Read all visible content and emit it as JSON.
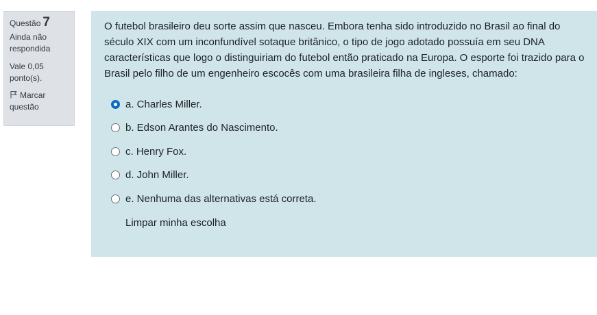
{
  "info": {
    "question_label": "Questão",
    "question_number": "7",
    "state": "Ainda não respondida",
    "grade": "Vale 0,05 ponto(s).",
    "flag_label": "Marcar questão"
  },
  "question": {
    "text": "O futebol brasileiro deu sorte assim que nasceu. Embora tenha sido introduzido no Brasil ao final do século XIX com um inconfundível sotaque britânico, o tipo de jogo adotado possuía em seu DNA características que logo o distinguiriam do futebol então praticado na Europa. O esporte foi trazido para o Brasil pelo filho de um engenheiro escocês com uma brasileira filha de ingleses, chamado:",
    "options": [
      {
        "label": "a. Charles Miller.",
        "selected": true
      },
      {
        "label": "b. Edson Arantes do Nascimento.",
        "selected": false
      },
      {
        "label": "c. Henry Fox.",
        "selected": false
      },
      {
        "label": "d. John Miller.",
        "selected": false
      },
      {
        "label": "e. Nenhuma das alternativas está correta.",
        "selected": false
      }
    ],
    "clear_label": "Limpar minha escolha"
  },
  "colors": {
    "content_bg": "#cfe5ea",
    "info_bg": "#dee2e6",
    "accent": "#0f6cbf"
  }
}
